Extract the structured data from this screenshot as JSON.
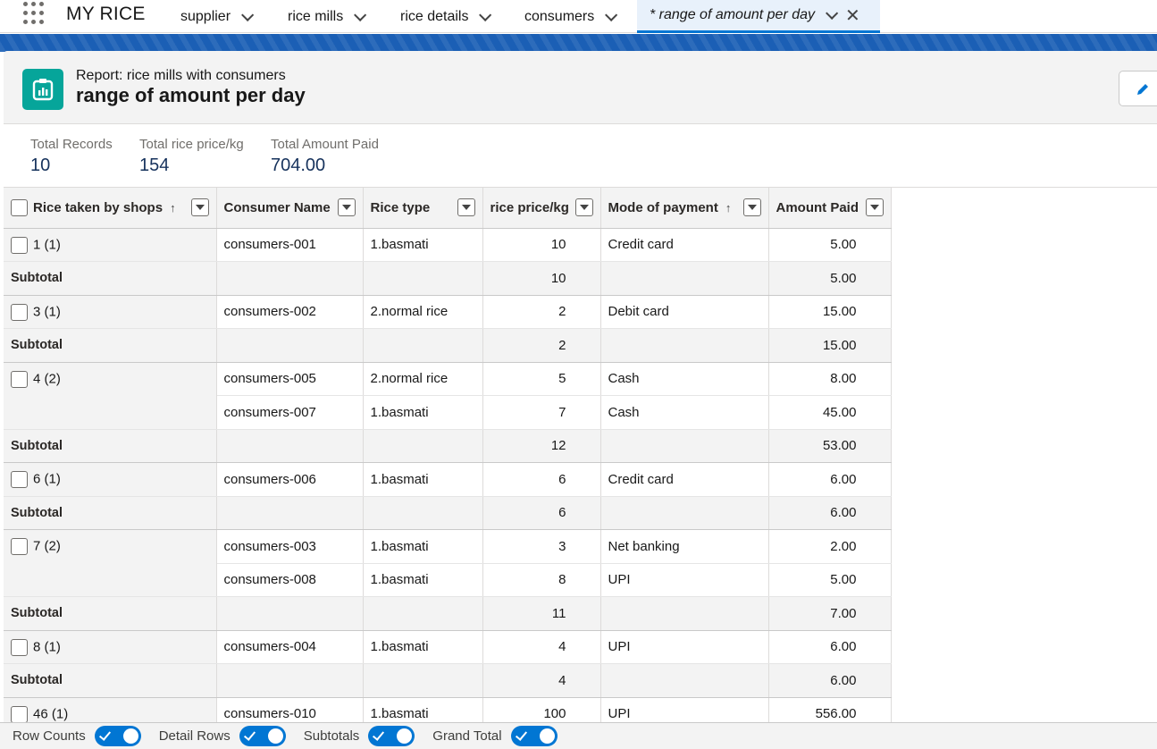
{
  "app": {
    "name": "MY RICE"
  },
  "nav": {
    "tabs": [
      {
        "label": "supplier"
      },
      {
        "label": "rice mills"
      },
      {
        "label": "rice details"
      },
      {
        "label": "consumers"
      },
      {
        "label": "* range of amount per day"
      }
    ]
  },
  "header": {
    "report_type": "Report: rice mills with consumers",
    "title": "range of amount per day"
  },
  "summary": [
    {
      "label": "Total Records",
      "value": "10"
    },
    {
      "label": "Total rice price/kg",
      "value": "154"
    },
    {
      "label": "Total Amount Paid",
      "value": "704.00"
    }
  ],
  "table": {
    "columns": [
      "Rice taken by shops",
      "Consumer Name",
      "Rice type",
      "rice price/kg",
      "Mode of payment",
      "Amount Paid"
    ],
    "subtotal_label": "Subtotal",
    "groups": [
      {
        "label": "1 (1)",
        "rows": [
          [
            "consumers-001",
            "1.basmati",
            "10",
            "Credit card",
            "5.00"
          ]
        ],
        "subtotal": [
          "10",
          "5.00"
        ]
      },
      {
        "label": "3 (1)",
        "rows": [
          [
            "consumers-002",
            "2.normal rice",
            "2",
            "Debit card",
            "15.00"
          ]
        ],
        "subtotal": [
          "2",
          "15.00"
        ]
      },
      {
        "label": "4 (2)",
        "rows": [
          [
            "consumers-005",
            "2.normal rice",
            "5",
            "Cash",
            "8.00"
          ],
          [
            "consumers-007",
            "1.basmati",
            "7",
            "Cash",
            "45.00"
          ]
        ],
        "subtotal": [
          "12",
          "53.00"
        ]
      },
      {
        "label": "6 (1)",
        "rows": [
          [
            "consumers-006",
            "1.basmati",
            "6",
            "Credit card",
            "6.00"
          ]
        ],
        "subtotal": [
          "6",
          "6.00"
        ]
      },
      {
        "label": "7 (2)",
        "rows": [
          [
            "consumers-003",
            "1.basmati",
            "3",
            "Net banking",
            "2.00"
          ],
          [
            "consumers-008",
            "1.basmati",
            "8",
            "UPI",
            "5.00"
          ]
        ],
        "subtotal": [
          "11",
          "7.00"
        ]
      },
      {
        "label": "8 (1)",
        "rows": [
          [
            "consumers-004",
            "1.basmati",
            "4",
            "UPI",
            "6.00"
          ]
        ],
        "subtotal": [
          "4",
          "6.00"
        ]
      },
      {
        "label": "46 (1)",
        "rows": [
          [
            "consumers-010",
            "1.basmati",
            "100",
            "UPI",
            "556.00"
          ]
        ],
        "subtotal": null
      }
    ]
  },
  "footer": {
    "toggles": [
      {
        "label": "Row Counts",
        "on": true
      },
      {
        "label": "Detail Rows",
        "on": true
      },
      {
        "label": "Subtotals",
        "on": true
      },
      {
        "label": "Grand Total",
        "on": true
      }
    ]
  },
  "colors": {
    "brand_blue": "#0176d3",
    "report_icon": "#06a59a",
    "band": "#1b5fb5"
  }
}
